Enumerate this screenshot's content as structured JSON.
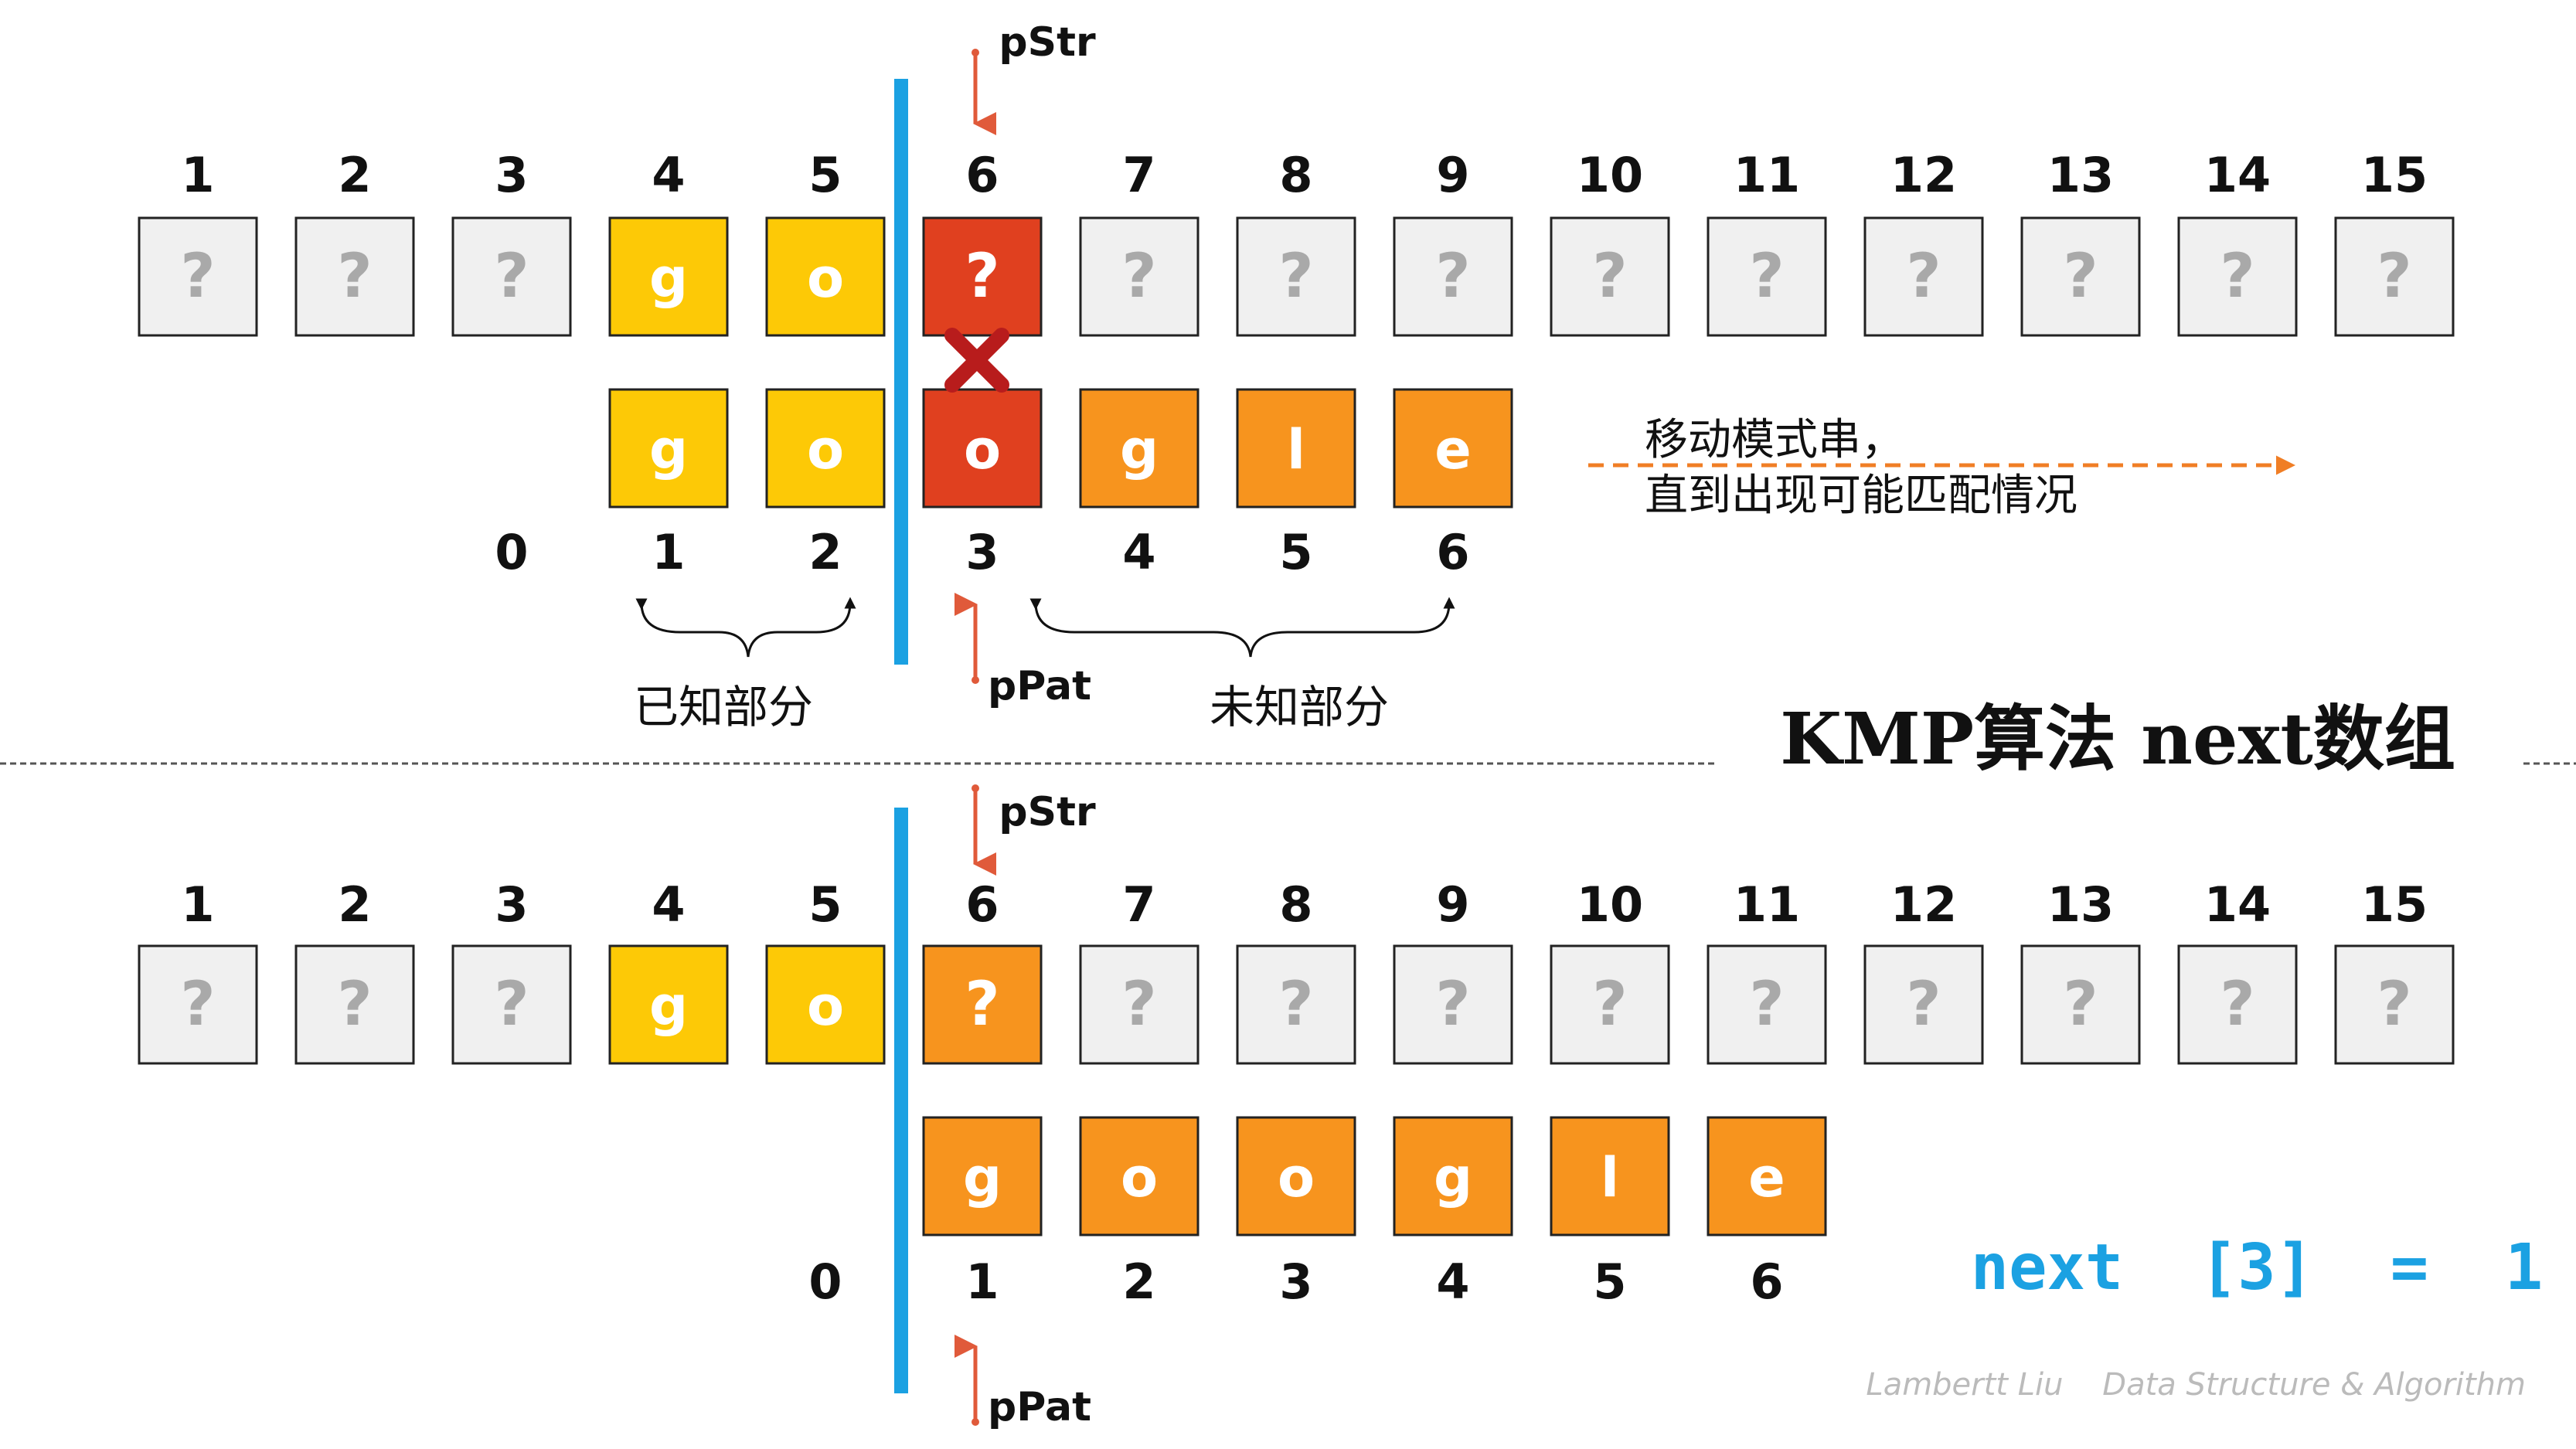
{
  "colors": {
    "grey": "#f0f0f0",
    "yellow": "#fdc906",
    "orange": "#f7941e",
    "red": "#e0401f",
    "blue": "#1ba1e2",
    "dark_red": "#b81c1c",
    "pointer": "#e05a3a",
    "dashed_arrow": "#f07e25",
    "next_text": "#1ba1e2"
  },
  "top": {
    "str_indices": [
      "1",
      "2",
      "3",
      "4",
      "5",
      "6",
      "7",
      "8",
      "9",
      "10",
      "11",
      "12",
      "13",
      "14",
      "15"
    ],
    "str_cells": [
      {
        "char": "?",
        "color": "grey"
      },
      {
        "char": "?",
        "color": "grey"
      },
      {
        "char": "?",
        "color": "grey"
      },
      {
        "char": "g",
        "color": "yellow"
      },
      {
        "char": "o",
        "color": "yellow"
      },
      {
        "char": "?",
        "color": "red"
      },
      {
        "char": "?",
        "color": "grey"
      },
      {
        "char": "?",
        "color": "grey"
      },
      {
        "char": "?",
        "color": "grey"
      },
      {
        "char": "?",
        "color": "grey"
      },
      {
        "char": "?",
        "color": "grey"
      },
      {
        "char": "?",
        "color": "grey"
      },
      {
        "char": "?",
        "color": "grey"
      },
      {
        "char": "?",
        "color": "grey"
      },
      {
        "char": "?",
        "color": "grey"
      }
    ],
    "pat_cells": [
      {
        "char": "g",
        "color": "yellow"
      },
      {
        "char": "o",
        "color": "yellow"
      },
      {
        "char": "o",
        "color": "red"
      },
      {
        "char": "g",
        "color": "orange"
      },
      {
        "char": "l",
        "color": "orange"
      },
      {
        "char": "e",
        "color": "orange"
      }
    ],
    "pat_indices": [
      "0",
      "1",
      "2",
      "3",
      "4",
      "5",
      "6"
    ],
    "pstr_label": "pStr",
    "ppat_label": "pPat",
    "known_label": "已知部分",
    "unknown_label": "未知部分",
    "note_line1": "移动模式串，",
    "note_line2": "直到出现可能匹配情况"
  },
  "title": "KMP算法 next数组",
  "bottom": {
    "str_indices": [
      "1",
      "2",
      "3",
      "4",
      "5",
      "6",
      "7",
      "8",
      "9",
      "10",
      "11",
      "12",
      "13",
      "14",
      "15"
    ],
    "str_cells": [
      {
        "char": "?",
        "color": "grey"
      },
      {
        "char": "?",
        "color": "grey"
      },
      {
        "char": "?",
        "color": "grey"
      },
      {
        "char": "g",
        "color": "yellow"
      },
      {
        "char": "o",
        "color": "yellow"
      },
      {
        "char": "?",
        "color": "orange"
      },
      {
        "char": "?",
        "color": "grey"
      },
      {
        "char": "?",
        "color": "grey"
      },
      {
        "char": "?",
        "color": "grey"
      },
      {
        "char": "?",
        "color": "grey"
      },
      {
        "char": "?",
        "color": "grey"
      },
      {
        "char": "?",
        "color": "grey"
      },
      {
        "char": "?",
        "color": "grey"
      },
      {
        "char": "?",
        "color": "grey"
      },
      {
        "char": "?",
        "color": "grey"
      }
    ],
    "pat_cells": [
      {
        "char": "g",
        "color": "orange"
      },
      {
        "char": "o",
        "color": "orange"
      },
      {
        "char": "o",
        "color": "orange"
      },
      {
        "char": "g",
        "color": "orange"
      },
      {
        "char": "l",
        "color": "orange"
      },
      {
        "char": "e",
        "color": "orange"
      }
    ],
    "pat_indices": [
      "0",
      "1",
      "2",
      "3",
      "4",
      "5",
      "6"
    ],
    "pstr_label": "pStr",
    "ppat_label": "pPat",
    "next_formula": "next  [3]  =  1"
  },
  "footer": "Lambertt Liu    Data Structure & Algorithm"
}
